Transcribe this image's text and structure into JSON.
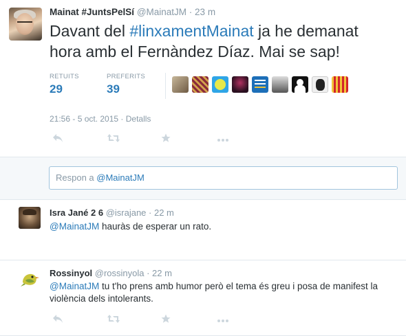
{
  "main_tweet": {
    "name": "Mainat #JuntsPelSí",
    "handle": "@MainatJM",
    "age": "23 m",
    "text_before": "Davant del ",
    "hashtag": "#linxamentMainat",
    "text_after": " ja he demanat hora amb el Fernàndez Díaz. Mai se sap!",
    "retweets_label": "RETUITS",
    "retweets": "29",
    "favorites_label": "PREFERITS",
    "favorites": "39",
    "timestamp": "21:56 - 5 oct. 2015",
    "details": "Detalls",
    "separator": " · ",
    "dot": " · "
  },
  "reply_box": {
    "prefix": "Respon a ",
    "handle": "@MainatJM"
  },
  "replies": [
    {
      "name": "Isra Jané 2 6",
      "handle": "@israjane",
      "age": "22 m",
      "mention": "@MainatJM",
      "text": " hauràs de esperar un rato."
    },
    {
      "name": "Rossinyol",
      "handle": "@rossinyola",
      "age": "22 m",
      "mention": "@MainatJM",
      "text": " tu t'ho prens amb humor però el tema és greu i posa de manifest la violència dels intolerants."
    }
  ],
  "favoriter_avatars": [
    "faded-gradient",
    "lines-pattern",
    "smiley",
    "dark-avatar",
    "keep-calm-badge",
    "bw-photo",
    "silhouette",
    "mask",
    "catalan-flag"
  ],
  "colors": {
    "link": "#2b7bb9",
    "muted": "#8899a6",
    "text": "#292f33",
    "background_alt": "#f5f8fa"
  },
  "icons": [
    "reply-icon",
    "retweet-icon",
    "favorite-icon",
    "more-icon"
  ]
}
